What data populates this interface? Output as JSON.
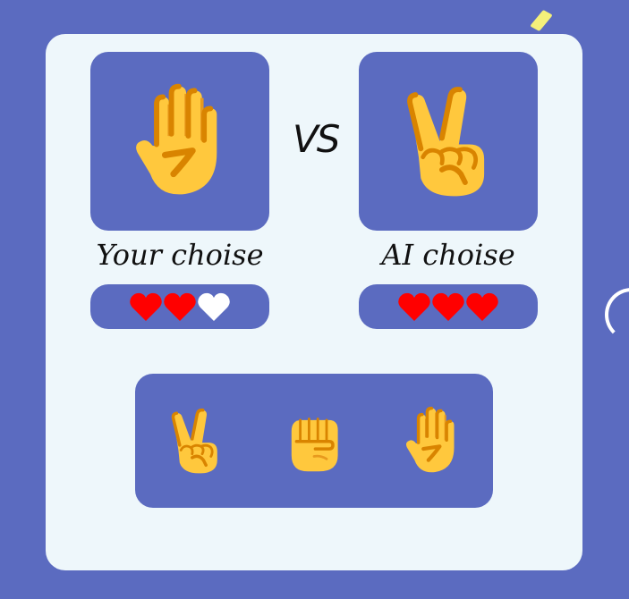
{
  "vs_label": "VS",
  "player": {
    "caption": "Your choise",
    "current_choice": "paper-hand-icon",
    "lives": [
      "full",
      "full",
      "empty"
    ]
  },
  "ai": {
    "caption": "AI choise",
    "current_choice": "scissors-hand-icon",
    "lives": [
      "full",
      "full",
      "full"
    ]
  },
  "options": [
    {
      "id": "scissors",
      "icon": "scissors-hand-icon"
    },
    {
      "id": "rock",
      "icon": "rock-fist-icon"
    },
    {
      "id": "paper",
      "icon": "paper-hand-icon"
    }
  ],
  "colors": {
    "page_bg": "#5b6bc0",
    "board_bg": "#eef7fb",
    "panel_bg": "#5b6bc0",
    "heart_full": "#ff0000",
    "heart_empty": "#ffffff",
    "hand_skin": "#ffc83d",
    "hand_shade": "#d98400"
  }
}
